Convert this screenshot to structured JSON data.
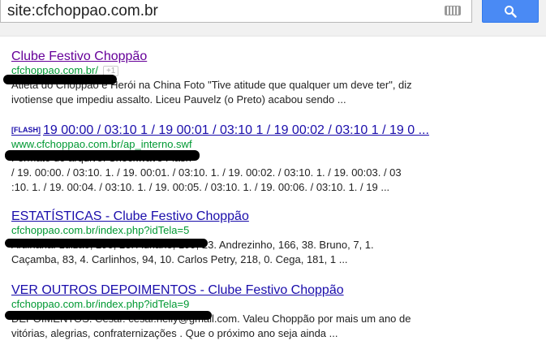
{
  "search": {
    "query": "site:cfchoppao.com.br"
  },
  "results": [
    {
      "title": "Clube Festivo Choppão",
      "url": "cfchoppao.com.br/",
      "plus_one": "+1",
      "snippet": [
        "Atleta do Choppão é Herói na China Foto \"Tive atitude que qualquer um deve ter\", diz",
        "ivotiense que impediu assalto. Liceu Pauvelz (o Preto) acabou sendo ..."
      ]
    },
    {
      "tag": "[FLASH]",
      "title": "19 00:00 / 03:10 1 / 19 00:01 / 03:10 1 / 19 00:02 / 03:10 1 / 19 0 ...",
      "url": "www.cfchoppao.com.br/ap_interno.swf",
      "snippet": [
        "Formato do arquivo: Shockwave Flash",
        "/ 19. 00:00. / 03:10. 1. / 19. 00:01. / 03:10. 1. / 19. 00:02. / 03:10. 1. / 19. 00:03. / 03",
        ":10. 1. / 19. 00:04. / 03:10. 1. / 19. 00:05. / 03:10. 1. / 19. 00:06. / 03:10. 1. / 19 ..."
      ]
    },
    {
      "title": "ESTATÍSTICAS - Clube Festivo Choppão",
      "url": "cfchoppao.com.br/index.php?idTela=5",
      "snippet": [
        "Artilharia: Luizão, 290, 23. Adriano, 199, 23. Andrezinho, 166, 38. Bruno, 7, 1.",
        "Caçamba, 83, 4. Carlinhos, 94, 10. Carlos Petry, 218, 0. Cega, 181, 1 ..."
      ]
    },
    {
      "title": "VER OUTROS DEPOIMENTOS - Clube Festivo Choppão",
      "url": "cfchoppao.com.br/index.php?idTela=9",
      "snippet": [
        "DEPOIMENTOS. Cesar. cesar.nelly@gmail.com. Valeu Choppão por mais um ano de",
        "vitórias, alegrias, confraternizações . Que o próximo ano seja ainda ..."
      ]
    }
  ]
}
